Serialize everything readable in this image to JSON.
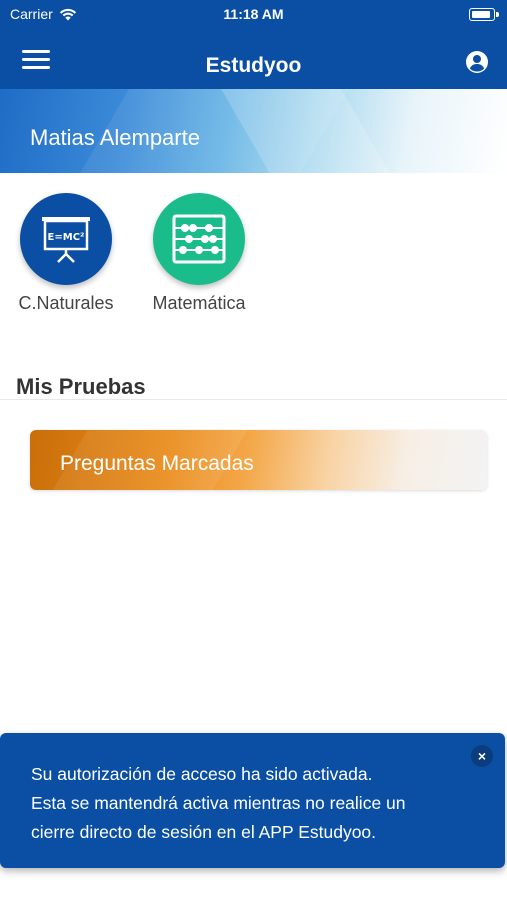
{
  "status_bar": {
    "carrier": "Carrier",
    "time": "11:18 AM"
  },
  "nav": {
    "title": "Estudyoo"
  },
  "profile": {
    "name": "Matias Alemparte"
  },
  "subjects": [
    {
      "label": "C.Naturales",
      "icon": "whiteboard-emc2-icon",
      "color": "#0a4fa3",
      "icon_text": "E=MC²"
    },
    {
      "label": "Matemática",
      "icon": "abacus-icon",
      "color": "#1abc8c"
    }
  ],
  "section": {
    "title": "Mis Pruebas"
  },
  "quiz_card": {
    "label": "Preguntas Marcadas"
  },
  "toast": {
    "lines": [
      "Su autorización de acceso ha sido activada.",
      "Esta se mantendrá activa mientras no realice un",
      "cierre directo de sesión en el APP Estudyoo."
    ],
    "close_symbol": "×"
  },
  "colors": {
    "primary": "#0a4fa3",
    "teal": "#1abc8c",
    "orange": "#e98a18"
  }
}
